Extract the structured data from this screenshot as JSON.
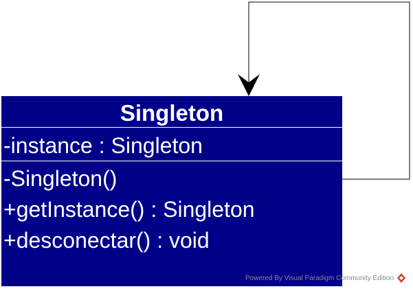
{
  "diagram": {
    "class": {
      "name": "Singleton",
      "attributes": [
        "-instance : Singleton"
      ],
      "operations": [
        "-Singleton()",
        "+getInstance() : Singleton",
        "+desconectar() : void"
      ]
    },
    "colors": {
      "class_fill": "#000088",
      "class_text": "#ffffff",
      "line": "#000000"
    },
    "self_association": {
      "arrowhead": "open-filled-arrow"
    }
  },
  "watermark": {
    "text": "Powered By  Visual Paradigm Community Edition",
    "icon": "visual-paradigm-logo-icon"
  }
}
